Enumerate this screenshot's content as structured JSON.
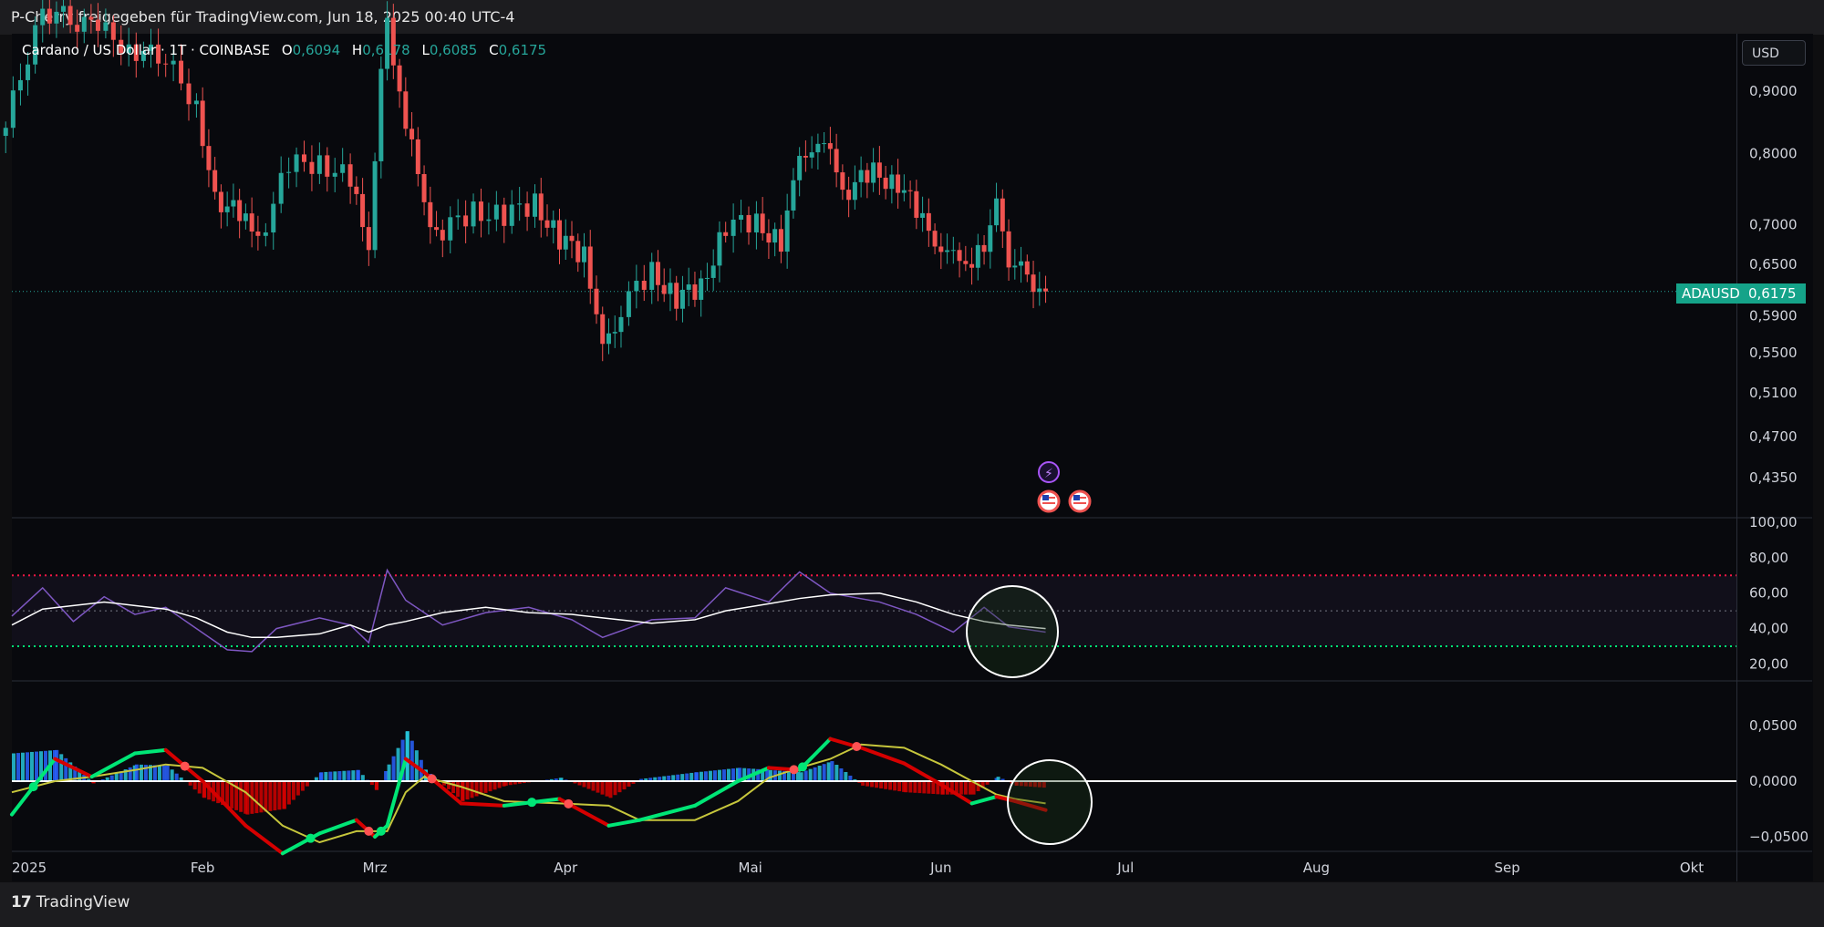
{
  "header": {
    "text": "P-Cherry freigegeben für TradingView.com, Jun 18, 2025 00:40 UTC-4"
  },
  "legend": {
    "symbol": "Cardano / US Dollar · 1T · COINBASE",
    "o_label": "O",
    "o_value": "0,6094",
    "h_label": "H",
    "h_value": "0,6178",
    "l_label": "L",
    "l_value": "0,6085",
    "c_label": "C",
    "c_value": "0,6175"
  },
  "currency_button": "USD",
  "price_tag": {
    "symbol": "ADAUSD",
    "value": "0,6175"
  },
  "brand": {
    "name": "TradingView"
  },
  "colors": {
    "up": "#26a69a",
    "down": "#ef5350",
    "rsi": "#7e57c2",
    "signal": "#ffffff",
    "macd_up": "#00e676",
    "macd_down": "#d50000",
    "macd_signal": "#c6c63c"
  },
  "chart_data": [
    {
      "type": "candlestick",
      "title": "Cardano / US Dollar · 1T · COINBASE",
      "x_tick_labels": [
        "2025",
        "Feb",
        "Mrz",
        "Apr",
        "Mai",
        "Jun",
        "Jul",
        "Aug",
        "Sep",
        "Okt"
      ],
      "x_tick_dates": [
        "2025-01-01",
        "2025-02-01",
        "2025-03-01",
        "2025-04-01",
        "2025-05-01",
        "2025-06-01",
        "2025-07-01",
        "2025-08-01",
        "2025-09-01",
        "2025-10-01"
      ],
      "y_scale": "log",
      "y_tick_labels": [
        "0,9000",
        "0,8000",
        "0,7000",
        "0,6500",
        "0,5900",
        "0,5500",
        "0,5100",
        "0,4700",
        "0,4350"
      ],
      "y_ticks": [
        0.9,
        0.8,
        0.7,
        0.65,
        0.59,
        0.55,
        0.51,
        0.47,
        0.435
      ],
      "last_price": 0.6175,
      "series": [
        {
          "date": "2024-12-31",
          "close": 0.84
        },
        {
          "date": "2025-01-06",
          "close": 1.05
        },
        {
          "date": "2025-01-15",
          "close": 1.01
        },
        {
          "date": "2025-01-20",
          "close": 0.98
        },
        {
          "date": "2025-01-26",
          "close": 0.95
        },
        {
          "date": "2025-01-31",
          "close": 0.88
        },
        {
          "date": "2025-02-02",
          "close": 0.78
        },
        {
          "date": "2025-02-03",
          "close": 0.74
        },
        {
          "date": "2025-02-07",
          "close": 0.71
        },
        {
          "date": "2025-02-10",
          "close": 0.68
        },
        {
          "date": "2025-02-15",
          "close": 0.78
        },
        {
          "date": "2025-02-20",
          "close": 0.79
        },
        {
          "date": "2025-02-25",
          "close": 0.76
        },
        {
          "date": "2025-02-28",
          "close": 0.66
        },
        {
          "date": "2025-03-02",
          "close": 0.95
        },
        {
          "date": "2025-03-03",
          "close": 1.02
        },
        {
          "date": "2025-03-06",
          "close": 0.85
        },
        {
          "date": "2025-03-09",
          "close": 0.72
        },
        {
          "date": "2025-03-12",
          "close": 0.69
        },
        {
          "date": "2025-03-17",
          "close": 0.72
        },
        {
          "date": "2025-03-22",
          "close": 0.71
        },
        {
          "date": "2025-03-27",
          "close": 0.73
        },
        {
          "date": "2025-03-31",
          "close": 0.68
        },
        {
          "date": "2025-04-04",
          "close": 0.66
        },
        {
          "date": "2025-04-07",
          "close": 0.57
        },
        {
          "date": "2025-04-08",
          "close": 0.56
        },
        {
          "date": "2025-04-10",
          "close": 0.6
        },
        {
          "date": "2025-04-15",
          "close": 0.64
        },
        {
          "date": "2025-04-19",
          "close": 0.61
        },
        {
          "date": "2025-04-23",
          "close": 0.62
        },
        {
          "date": "2025-04-27",
          "close": 0.7
        },
        {
          "date": "2025-05-02",
          "close": 0.7
        },
        {
          "date": "2025-05-06",
          "close": 0.68
        },
        {
          "date": "2025-05-09",
          "close": 0.78
        },
        {
          "date": "2025-05-11",
          "close": 0.82
        },
        {
          "date": "2025-05-14",
          "close": 0.79
        },
        {
          "date": "2025-05-17",
          "close": 0.75
        },
        {
          "date": "2025-05-21",
          "close": 0.77
        },
        {
          "date": "2025-05-25",
          "close": 0.76
        },
        {
          "date": "2025-05-29",
          "close": 0.7
        },
        {
          "date": "2025-06-01",
          "close": 0.68
        },
        {
          "date": "2025-06-04",
          "close": 0.64
        },
        {
          "date": "2025-06-08",
          "close": 0.68
        },
        {
          "date": "2025-06-10",
          "close": 0.72
        },
        {
          "date": "2025-06-12",
          "close": 0.66
        },
        {
          "date": "2025-06-14",
          "close": 0.64
        },
        {
          "date": "2025-06-16",
          "close": 0.63
        },
        {
          "date": "2025-06-18",
          "close": 0.6175
        }
      ]
    },
    {
      "type": "line",
      "y_tick_labels": [
        "100,00",
        "80,00",
        "60,00",
        "40,00",
        "20,00"
      ],
      "y_ticks": [
        100,
        80,
        60,
        40,
        20
      ],
      "ylim": [
        12,
        100
      ],
      "overbought": 70,
      "oversold": 30,
      "midline": 50,
      "series": [
        {
          "values": [
            {
              "date": "2025-01-01",
              "rsi": 47,
              "signal": 42
            },
            {
              "date": "2025-01-06",
              "rsi": 63,
              "signal": 51
            },
            {
              "date": "2025-01-11",
              "rsi": 44,
              "signal": 53
            },
            {
              "date": "2025-01-16",
              "rsi": 58,
              "signal": 55
            },
            {
              "date": "2025-01-21",
              "rsi": 48,
              "signal": 53
            },
            {
              "date": "2025-01-26",
              "rsi": 52,
              "signal": 51
            },
            {
              "date": "2025-01-31",
              "rsi": 40,
              "signal": 46
            },
            {
              "date": "2025-02-05",
              "rsi": 28,
              "signal": 38
            },
            {
              "date": "2025-02-09",
              "rsi": 27,
              "signal": 35
            },
            {
              "date": "2025-02-13",
              "rsi": 40,
              "signal": 35
            },
            {
              "date": "2025-02-20",
              "rsi": 46,
              "signal": 37
            },
            {
              "date": "2025-02-25",
              "rsi": 42,
              "signal": 42
            },
            {
              "date": "2025-02-28",
              "rsi": 32,
              "signal": 38
            },
            {
              "date": "2025-03-03",
              "rsi": 73,
              "signal": 42
            },
            {
              "date": "2025-03-06",
              "rsi": 56,
              "signal": 44
            },
            {
              "date": "2025-03-12",
              "rsi": 42,
              "signal": 49
            },
            {
              "date": "2025-03-19",
              "rsi": 49,
              "signal": 52
            },
            {
              "date": "2025-03-26",
              "rsi": 52,
              "signal": 49
            },
            {
              "date": "2025-04-02",
              "rsi": 45,
              "signal": 48
            },
            {
              "date": "2025-04-07",
              "rsi": 35,
              "signal": 46
            },
            {
              "date": "2025-04-15",
              "rsi": 45,
              "signal": 43
            },
            {
              "date": "2025-04-22",
              "rsi": 46,
              "signal": 45
            },
            {
              "date": "2025-04-27",
              "rsi": 63,
              "signal": 50
            },
            {
              "date": "2025-05-04",
              "rsi": 55,
              "signal": 54
            },
            {
              "date": "2025-05-09",
              "rsi": 72,
              "signal": 57
            },
            {
              "date": "2025-05-14",
              "rsi": 60,
              "signal": 59
            },
            {
              "date": "2025-05-22",
              "rsi": 55,
              "signal": 60
            },
            {
              "date": "2025-05-28",
              "rsi": 48,
              "signal": 55
            },
            {
              "date": "2025-06-03",
              "rsi": 38,
              "signal": 48
            },
            {
              "date": "2025-06-08",
              "rsi": 52,
              "signal": 44
            },
            {
              "date": "2025-06-12",
              "rsi": 41,
              "signal": 42
            },
            {
              "date": "2025-06-18",
              "rsi": 38,
              "signal": 40
            }
          ]
        }
      ]
    },
    {
      "type": "line",
      "y_tick_labels": [
        "0,0500",
        "0,0000",
        "−0,0500"
      ],
      "y_ticks": [
        0.05,
        0.0,
        -0.05
      ],
      "ylim": [
        -0.062,
        0.1
      ],
      "series": [
        {
          "values": [
            {
              "date": "2025-01-01",
              "macd": -0.03,
              "signal": -0.01,
              "hist": 0.025
            },
            {
              "date": "2025-01-08",
              "macd": 0.02,
              "signal": 0.0,
              "hist": 0.028
            },
            {
              "date": "2025-01-14",
              "macd": 0.004,
              "signal": 0.004,
              "hist": -0.002
            },
            {
              "date": "2025-01-21",
              "macd": 0.025,
              "signal": 0.01,
              "hist": 0.015
            },
            {
              "date": "2025-01-26",
              "macd": 0.028,
              "signal": 0.015,
              "hist": 0.014
            },
            {
              "date": "2025-02-01",
              "macd": 0.0,
              "signal": 0.012,
              "hist": -0.015
            },
            {
              "date": "2025-02-08",
              "macd": -0.04,
              "signal": -0.01,
              "hist": -0.03
            },
            {
              "date": "2025-02-14",
              "macd": -0.065,
              "signal": -0.04,
              "hist": -0.025
            },
            {
              "date": "2025-02-20",
              "macd": -0.047,
              "signal": -0.055,
              "hist": 0.008
            },
            {
              "date": "2025-02-26",
              "macd": -0.035,
              "signal": -0.045,
              "hist": 0.01
            },
            {
              "date": "2025-03-01",
              "macd": -0.05,
              "signal": -0.045,
              "hist": -0.008
            },
            {
              "date": "2025-03-03",
              "macd": -0.04,
              "signal": -0.045,
              "hist": 0.015
            },
            {
              "date": "2025-03-06",
              "macd": 0.02,
              "signal": -0.01,
              "hist": 0.045
            },
            {
              "date": "2025-03-09",
              "macd": 0.008,
              "signal": 0.004,
              "hist": 0.01
            },
            {
              "date": "2025-03-15",
              "macd": -0.02,
              "signal": -0.005,
              "hist": -0.018
            },
            {
              "date": "2025-03-22",
              "macd": -0.022,
              "signal": -0.018,
              "hist": -0.004
            },
            {
              "date": "2025-03-31",
              "macd": -0.016,
              "signal": -0.02,
              "hist": 0.003
            },
            {
              "date": "2025-04-08",
              "macd": -0.04,
              "signal": -0.022,
              "hist": -0.015
            },
            {
              "date": "2025-04-13",
              "macd": -0.035,
              "signal": -0.035,
              "hist": 0.002
            },
            {
              "date": "2025-04-22",
              "macd": -0.022,
              "signal": -0.035,
              "hist": 0.008
            },
            {
              "date": "2025-04-29",
              "macd": 0.0,
              "signal": -0.018,
              "hist": 0.012
            },
            {
              "date": "2025-05-04",
              "macd": 0.012,
              "signal": 0.003,
              "hist": 0.01
            },
            {
              "date": "2025-05-09",
              "macd": 0.01,
              "signal": 0.012,
              "hist": 0.008
            },
            {
              "date": "2025-05-14",
              "macd": 0.038,
              "signal": 0.02,
              "hist": 0.018
            },
            {
              "date": "2025-05-19",
              "macd": 0.03,
              "signal": 0.033,
              "hist": -0.004
            },
            {
              "date": "2025-05-26",
              "macd": 0.016,
              "signal": 0.03,
              "hist": -0.01
            },
            {
              "date": "2025-06-01",
              "macd": -0.003,
              "signal": 0.015,
              "hist": -0.012
            },
            {
              "date": "2025-06-06",
              "macd": -0.02,
              "signal": 0.0,
              "hist": -0.012
            },
            {
              "date": "2025-06-10",
              "macd": -0.014,
              "signal": -0.012,
              "hist": 0.004
            },
            {
              "date": "2025-06-13",
              "macd": -0.018,
              "signal": -0.016,
              "hist": -0.004
            },
            {
              "date": "2025-06-18",
              "macd": -0.026,
              "signal": -0.02,
              "hist": -0.006
            }
          ]
        }
      ]
    }
  ],
  "event_icons": [
    "lightning-icon",
    "us-flag-icon",
    "us-flag-icon"
  ]
}
